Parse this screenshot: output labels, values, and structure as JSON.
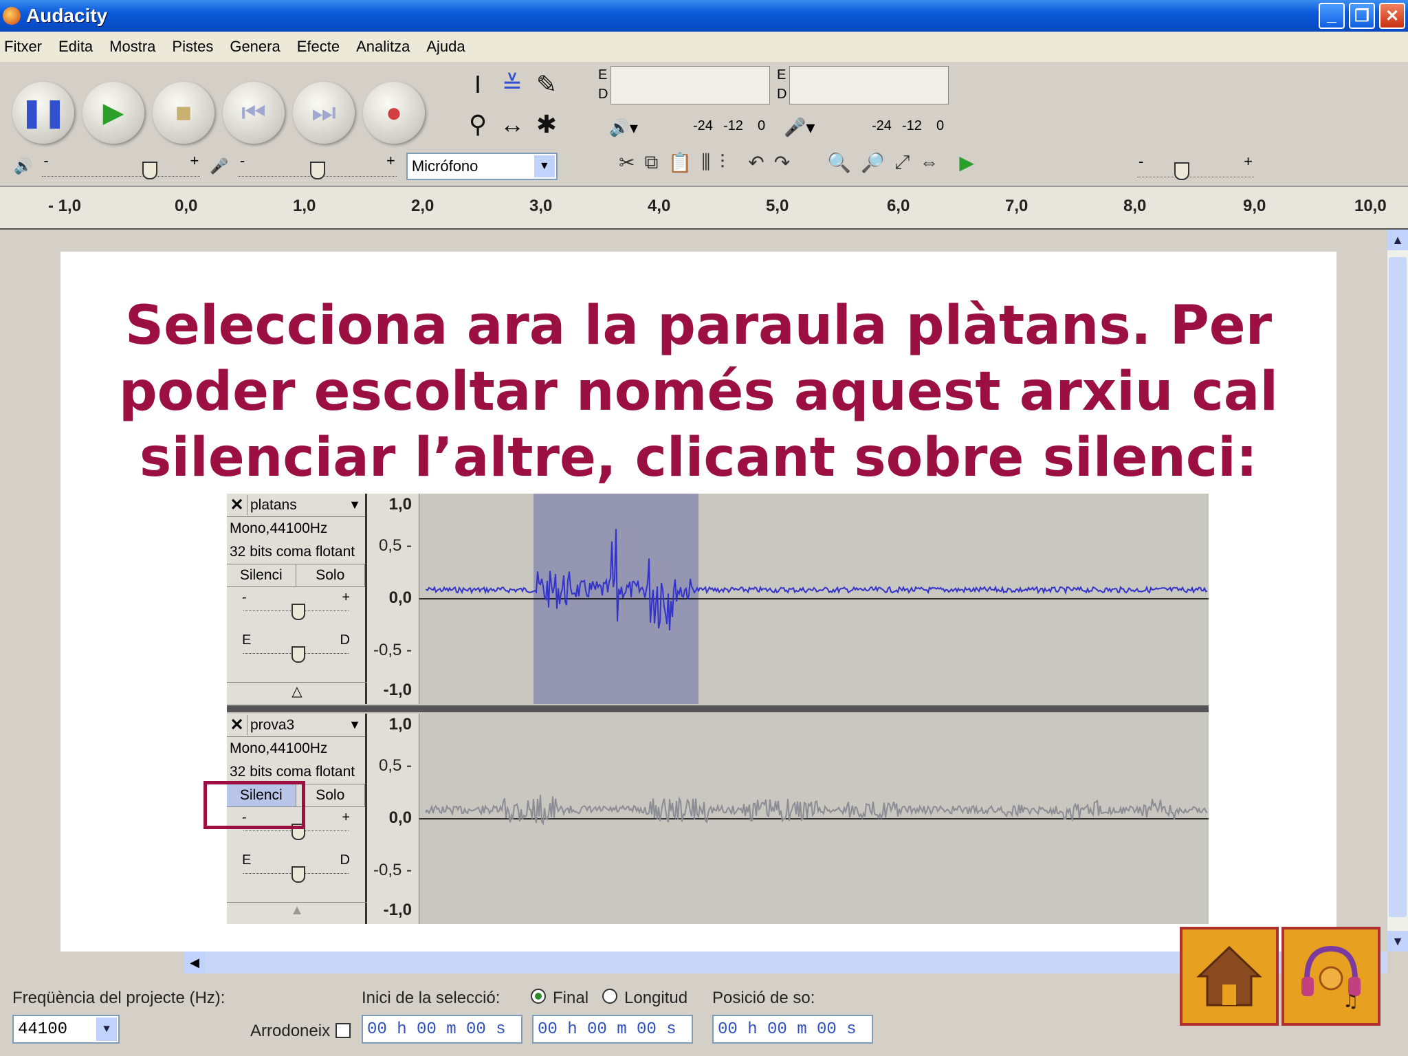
{
  "window": {
    "title": "Audacity"
  },
  "menu": [
    "Fitxer",
    "Edita",
    "Mostra",
    "Pistes",
    "Genera",
    "Efecte",
    "Analitza",
    "Ajuda"
  ],
  "meters": {
    "out_e": "E",
    "out_d": "D",
    "in_e": "E",
    "in_d": "D",
    "scale": [
      "-24",
      "-12",
      "0"
    ]
  },
  "mixer": {
    "input_source": "Micrófono",
    "minus": "-",
    "plus": "+"
  },
  "ruler": [
    "- 1,0",
    "0,0",
    "1,0",
    "2,0",
    "3,0",
    "4,0",
    "5,0",
    "6,0",
    "7,0",
    "8,0",
    "9,0",
    "10,0"
  ],
  "instruction": "Selecciona ara la paraula plàtans. Per poder escoltar només aquest arxiu cal silenciar l’altre, clicant sobre silenci:",
  "tracks": [
    {
      "name": "platans",
      "format": "Mono,44100Hz",
      "bits": "32 bits coma flotant",
      "mute": "Silenci",
      "solo": "Solo",
      "gain_minus": "-",
      "gain_plus": "+",
      "pan_left": "E",
      "pan_right": "D",
      "scale": [
        "1,0",
        "0,5 -",
        "0,0",
        "-0,5 -",
        "-1,0"
      ],
      "wave_color": "#3333cc",
      "selected": true
    },
    {
      "name": "prova3",
      "format": "Mono,44100Hz",
      "bits": "32 bits coma flotant",
      "mute": "Silenci",
      "solo": "Solo",
      "gain_minus": "-",
      "gain_plus": "+",
      "pan_left": "E",
      "pan_right": "D",
      "scale": [
        "1,0",
        "0,5 -",
        "0,0",
        "-0,5 -",
        "-1,0"
      ],
      "wave_color": "#8c8c94",
      "selected": false
    }
  ],
  "status": {
    "rate_label": "Freqüència del projecte (Hz):",
    "rate_value": "44100",
    "snap_label": "Arrodoneix",
    "sel_start_label": "Inici de la selecció:",
    "end_label": "Final",
    "length_label": "Longitud",
    "sel_start": "00 h 00 m 00 s",
    "sel_end": "00 h 00 m 00 s",
    "pos_label": "Posició de so:",
    "pos_value": "00 h 00 m 00 s"
  },
  "colors": {
    "accent": "#9b1040",
    "nav_bg": "#e8a020"
  }
}
